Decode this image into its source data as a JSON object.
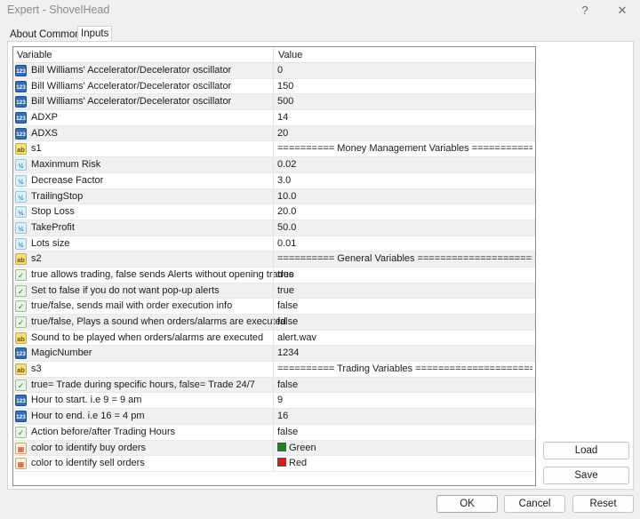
{
  "window": {
    "title": "Expert - ShovelHead",
    "help_glyph": "?",
    "close_glyph": "✕"
  },
  "tabs": [
    {
      "label": "About"
    },
    {
      "label": "Common"
    },
    {
      "label": "Inputs"
    }
  ],
  "table": {
    "headers": {
      "variable": "Variable",
      "value": "Value"
    },
    "rows": [
      {
        "icon": "123",
        "type": "int",
        "variable": "Bill Williams' Accelerator/Decelerator oscillator",
        "value": "0"
      },
      {
        "icon": "123",
        "type": "int",
        "variable": "Bill Williams' Accelerator/Decelerator oscillator",
        "value": "150"
      },
      {
        "icon": "123",
        "type": "int",
        "variable": "Bill Williams' Accelerator/Decelerator oscillator",
        "value": "500"
      },
      {
        "icon": "123",
        "type": "int",
        "variable": "ADXP",
        "value": "14"
      },
      {
        "icon": "123",
        "type": "int",
        "variable": "ADXS",
        "value": "20"
      },
      {
        "icon": "ab",
        "type": "str",
        "variable": "s1",
        "value": "========== Money Management Variables ====================..."
      },
      {
        "icon": "½",
        "type": "dbl",
        "variable": "Maxinmum Risk",
        "value": "0.02"
      },
      {
        "icon": "½",
        "type": "dbl",
        "variable": "Decrease Factor",
        "value": "3.0"
      },
      {
        "icon": "½",
        "type": "dbl",
        "variable": "TrailingStop",
        "value": "10.0"
      },
      {
        "icon": "½",
        "type": "dbl",
        "variable": "Stop Loss",
        "value": "20.0"
      },
      {
        "icon": "½",
        "type": "dbl",
        "variable": "TakeProfit",
        "value": "50.0"
      },
      {
        "icon": "½",
        "type": "dbl",
        "variable": "Lots size",
        "value": "0.01"
      },
      {
        "icon": "ab",
        "type": "str",
        "variable": "s2",
        "value": "========== General Variables ===============================..."
      },
      {
        "icon": "✓",
        "type": "bool",
        "variable": "true allows trading, false sends Alerts without opening trades",
        "value": "true"
      },
      {
        "icon": "✓",
        "type": "bool",
        "variable": "Set to false if you do not want pop-up alerts",
        "value": "true"
      },
      {
        "icon": "✓",
        "type": "bool",
        "variable": "true/false, sends mail with order execution info",
        "value": "false"
      },
      {
        "icon": "✓",
        "type": "bool",
        "variable": "true/false, Plays a sound when orders/alarms are executed",
        "value": "false"
      },
      {
        "icon": "ab",
        "type": "str",
        "variable": "Sound to be played when orders/alarms are executed",
        "value": "alert.wav"
      },
      {
        "icon": "123",
        "type": "int",
        "variable": "MagicNumber",
        "value": "1234"
      },
      {
        "icon": "ab",
        "type": "str",
        "variable": "s3",
        "value": "========== Trading Variables ===============================..."
      },
      {
        "icon": "✓",
        "type": "bool",
        "variable": "true= Trade during specific hours, false= Trade 24/7",
        "value": "false"
      },
      {
        "icon": "123",
        "type": "int",
        "variable": "Hour to start. i.e 9 = 9 am",
        "value": "9"
      },
      {
        "icon": "123",
        "type": "int",
        "variable": "Hour to end. i.e 16 = 4 pm",
        "value": "16"
      },
      {
        "icon": "✓",
        "type": "bool",
        "variable": "Action before/after Trading Hours",
        "value": "false"
      },
      {
        "icon": "▦",
        "type": "col",
        "variable": "color to identify buy orders",
        "value": "Green",
        "swatch": "#138a13"
      },
      {
        "icon": "▦",
        "type": "col",
        "variable": "color to identify sell orders",
        "value": "Red",
        "swatch": "#ee1111"
      }
    ]
  },
  "side_buttons": {
    "load": "Load",
    "save": "Save"
  },
  "footer_buttons": {
    "ok": "OK",
    "cancel": "Cancel",
    "reset": "Reset"
  }
}
